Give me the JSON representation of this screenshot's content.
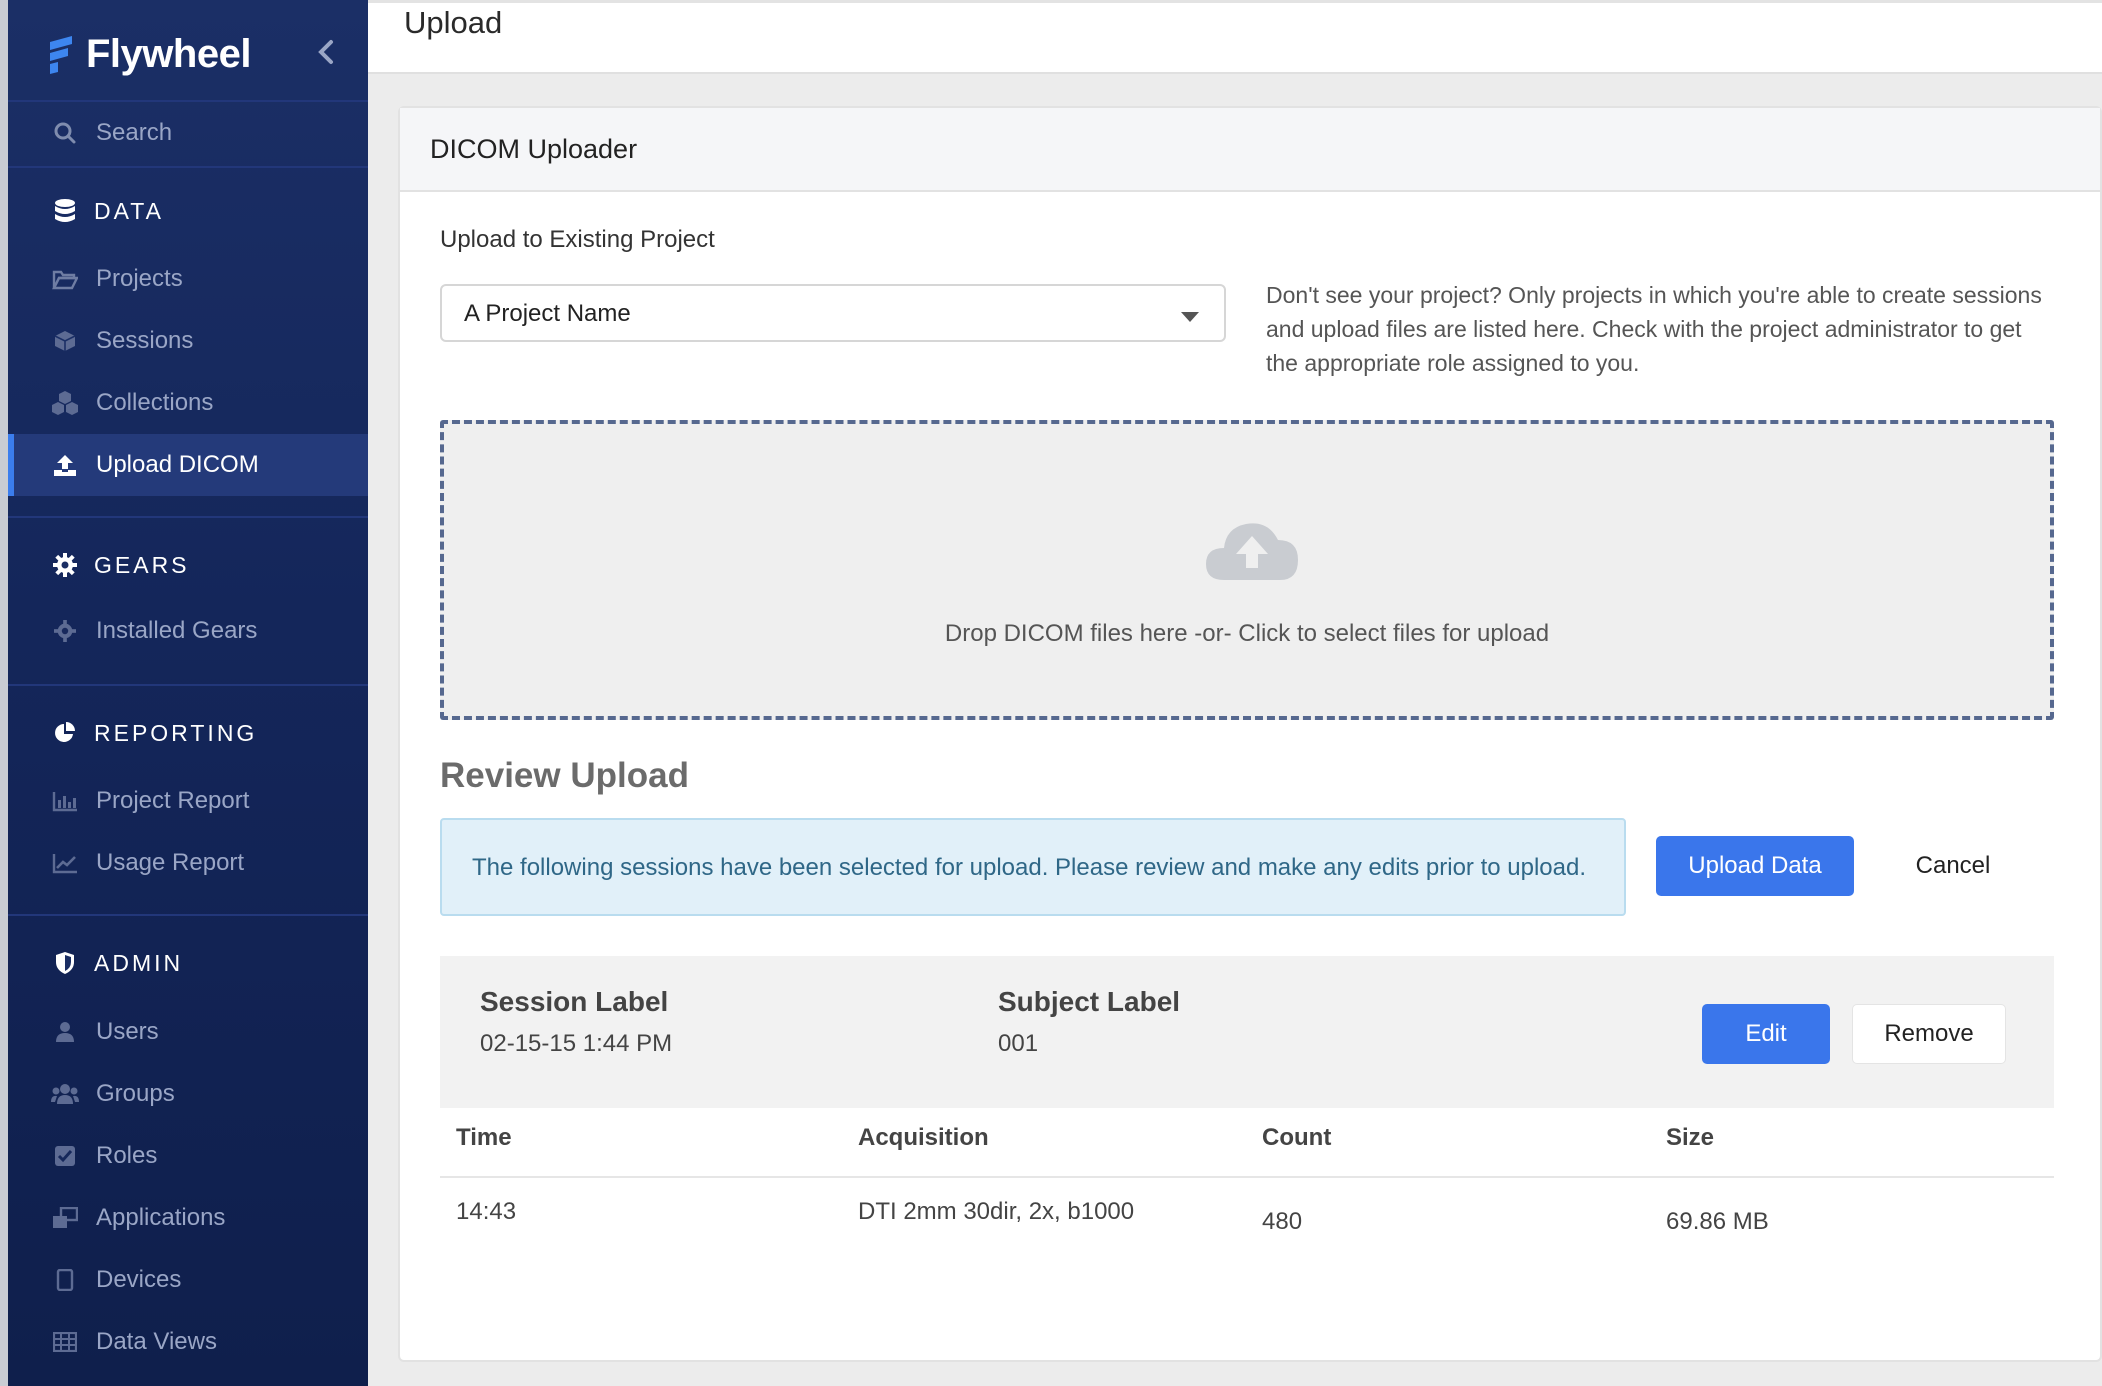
{
  "brand": {
    "name": "Flywheel"
  },
  "sidebar": {
    "search_label": "Search",
    "sections": {
      "data": {
        "title": "DATA",
        "items": [
          "Projects",
          "Sessions",
          "Collections",
          "Upload DICOM"
        ]
      },
      "gears": {
        "title": "GEARS",
        "items": [
          "Installed Gears"
        ]
      },
      "reporting": {
        "title": "REPORTING",
        "items": [
          "Project Report",
          "Usage Report"
        ]
      },
      "admin": {
        "title": "ADMIN",
        "items": [
          "Users",
          "Groups",
          "Roles",
          "Applications",
          "Devices",
          "Data Views"
        ]
      }
    },
    "active_item": "Upload DICOM"
  },
  "header": {
    "title": "Upload"
  },
  "card": {
    "title": "DICOM Uploader",
    "project_label": "Upload to Existing Project",
    "project_select": {
      "value": "A Project Name"
    },
    "help_text": "Don't see your project? Only projects in which you're able to create sessions and upload files are listed here. Check with the project administrator to get the appropriate role assigned to you.",
    "dropzone_text": "Drop DICOM files here -or- Click to select files for upload",
    "review": {
      "title": "Review Upload",
      "notice": "The following sessions have been selected for upload. Please review and make any edits prior to upload.",
      "upload_button": "Upload Data",
      "cancel_button": "Cancel",
      "session": {
        "session_label_h": "Session Label",
        "session_label": "02-15-15 1:44 PM",
        "subject_label_h": "Subject Label",
        "subject_label": "001",
        "edit_button": "Edit",
        "remove_button": "Remove"
      },
      "table": {
        "columns": [
          "Time",
          "Acquisition",
          "Count",
          "Size"
        ],
        "rows": [
          [
            "14:43",
            "DTI 2mm 30dir, 2x, b1000",
            "480",
            "69.86 MB"
          ]
        ]
      }
    }
  },
  "colors": {
    "sidebar_bg": "#14265a",
    "accent": "#3a76eb",
    "notice_bg": "#e1f0f9"
  }
}
